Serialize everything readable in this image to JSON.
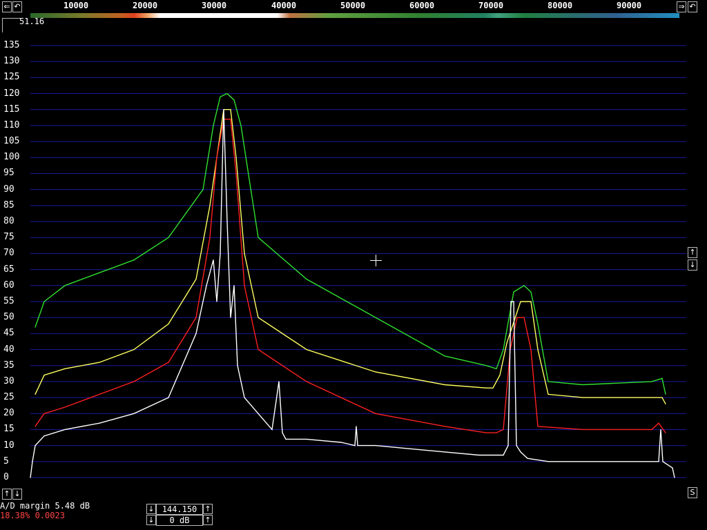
{
  "freq_axis": {
    "labels": [
      "10000",
      "20000",
      "30000",
      "40000",
      "50000",
      "60000",
      "70000",
      "80000",
      "90000"
    ],
    "left_buttons": [
      "⇐",
      "↶"
    ],
    "right_buttons": [
      "⇒",
      "↶"
    ]
  },
  "readout": {
    "value": "51.16"
  },
  "side_buttons": {
    "up": "↑",
    "down": "↓",
    "bottom_left_up": "↑",
    "bottom_left_down": "↓",
    "bottom_right": "S"
  },
  "status": {
    "ad_margin": "A/D margin   5.48 dB",
    "overload": "18.38% 0.0023"
  },
  "controls": {
    "freq_value": "144.150",
    "gain_value": "0 dB",
    "down_label": "↓",
    "up_label": "↑"
  },
  "colors": {
    "grid": "#1a1aa0",
    "white_trace": "#ffffff",
    "red_trace": "#ff2020",
    "yellow_trace": "#ffff60",
    "green_trace": "#30e030"
  },
  "chart_data": {
    "type": "line",
    "ylabel_ticks": [
      0,
      5,
      10,
      15,
      20,
      25,
      30,
      35,
      40,
      45,
      50,
      55,
      60,
      65,
      70,
      75,
      80,
      85,
      90,
      95,
      100,
      105,
      110,
      115,
      120,
      125,
      130,
      135
    ],
    "ylim": [
      0,
      135
    ],
    "xlim": [
      0,
      95000
    ],
    "grid": true,
    "series": [
      {
        "color": "#30e030",
        "x": [
          700,
          2000,
          5000,
          10000,
          15000,
          20000,
          25000,
          26500,
          27500,
          28500,
          29500,
          30500,
          33000,
          40000,
          50000,
          60000,
          66000,
          67500,
          68500,
          70000,
          71500,
          72500,
          73500,
          75000,
          80000,
          90000,
          91500,
          92000
        ],
        "values": [
          47,
          55,
          60,
          64,
          68,
          75,
          90,
          110,
          119,
          120,
          118,
          110,
          75,
          62,
          50,
          38,
          35,
          34,
          40,
          58,
          60,
          58,
          48,
          30,
          29,
          30,
          31,
          26
        ]
      },
      {
        "color": "#ffff60",
        "x": [
          700,
          2000,
          5000,
          10000,
          15000,
          20000,
          24000,
          26000,
          27000,
          28000,
          29000,
          29800,
          31000,
          33000,
          40000,
          50000,
          60000,
          66000,
          67000,
          68000,
          69000,
          71000,
          72500,
          73500,
          75000,
          80000,
          90000,
          91500,
          92000
        ],
        "values": [
          26,
          32,
          34,
          36,
          40,
          48,
          62,
          85,
          100,
          115,
          115,
          100,
          70,
          50,
          40,
          33,
          29,
          28,
          28,
          32,
          42,
          55,
          55,
          40,
          26,
          25,
          25,
          25,
          23
        ]
      },
      {
        "color": "#ff2020",
        "x": [
          700,
          2000,
          5000,
          10000,
          15000,
          20000,
          24000,
          26000,
          27000,
          28000,
          29000,
          29800,
          31000,
          33000,
          40000,
          50000,
          60000,
          66000,
          67500,
          68500,
          69500,
          70500,
          71500,
          72500,
          73500,
          80000,
          90000,
          91000,
          92000
        ],
        "values": [
          16,
          20,
          22,
          26,
          30,
          36,
          50,
          75,
          100,
          112,
          112,
          95,
          60,
          40,
          30,
          20,
          16,
          14,
          14,
          15,
          40,
          50,
          50,
          40,
          16,
          15,
          15,
          17,
          14
        ]
      },
      {
        "color": "#ffffff",
        "x": [
          0,
          300,
          700,
          2000,
          5000,
          10000,
          15000,
          20000,
          24000,
          25500,
          26500,
          27000,
          27500,
          28000,
          28500,
          29000,
          29500,
          30000,
          31000,
          33000,
          35000,
          36000,
          36500,
          37000,
          40000,
          45000,
          47000,
          47200,
          47400,
          50000,
          55000,
          60000,
          65000,
          67000,
          68500,
          69200,
          69600,
          70000,
          70400,
          71000,
          72000,
          75000,
          80000,
          85000,
          90000,
          91000,
          91300,
          91600,
          93000,
          93300
        ],
        "values": [
          0,
          5,
          10,
          13,
          15,
          17,
          20,
          25,
          45,
          60,
          68,
          55,
          70,
          115,
          80,
          50,
          60,
          35,
          25,
          20,
          15,
          30,
          14,
          12,
          12,
          11,
          10,
          16,
          10,
          10,
          9,
          8,
          7,
          7,
          7,
          10,
          55,
          55,
          10,
          8,
          6,
          5,
          5,
          5,
          5,
          5,
          15,
          5,
          3,
          0
        ]
      }
    ]
  }
}
